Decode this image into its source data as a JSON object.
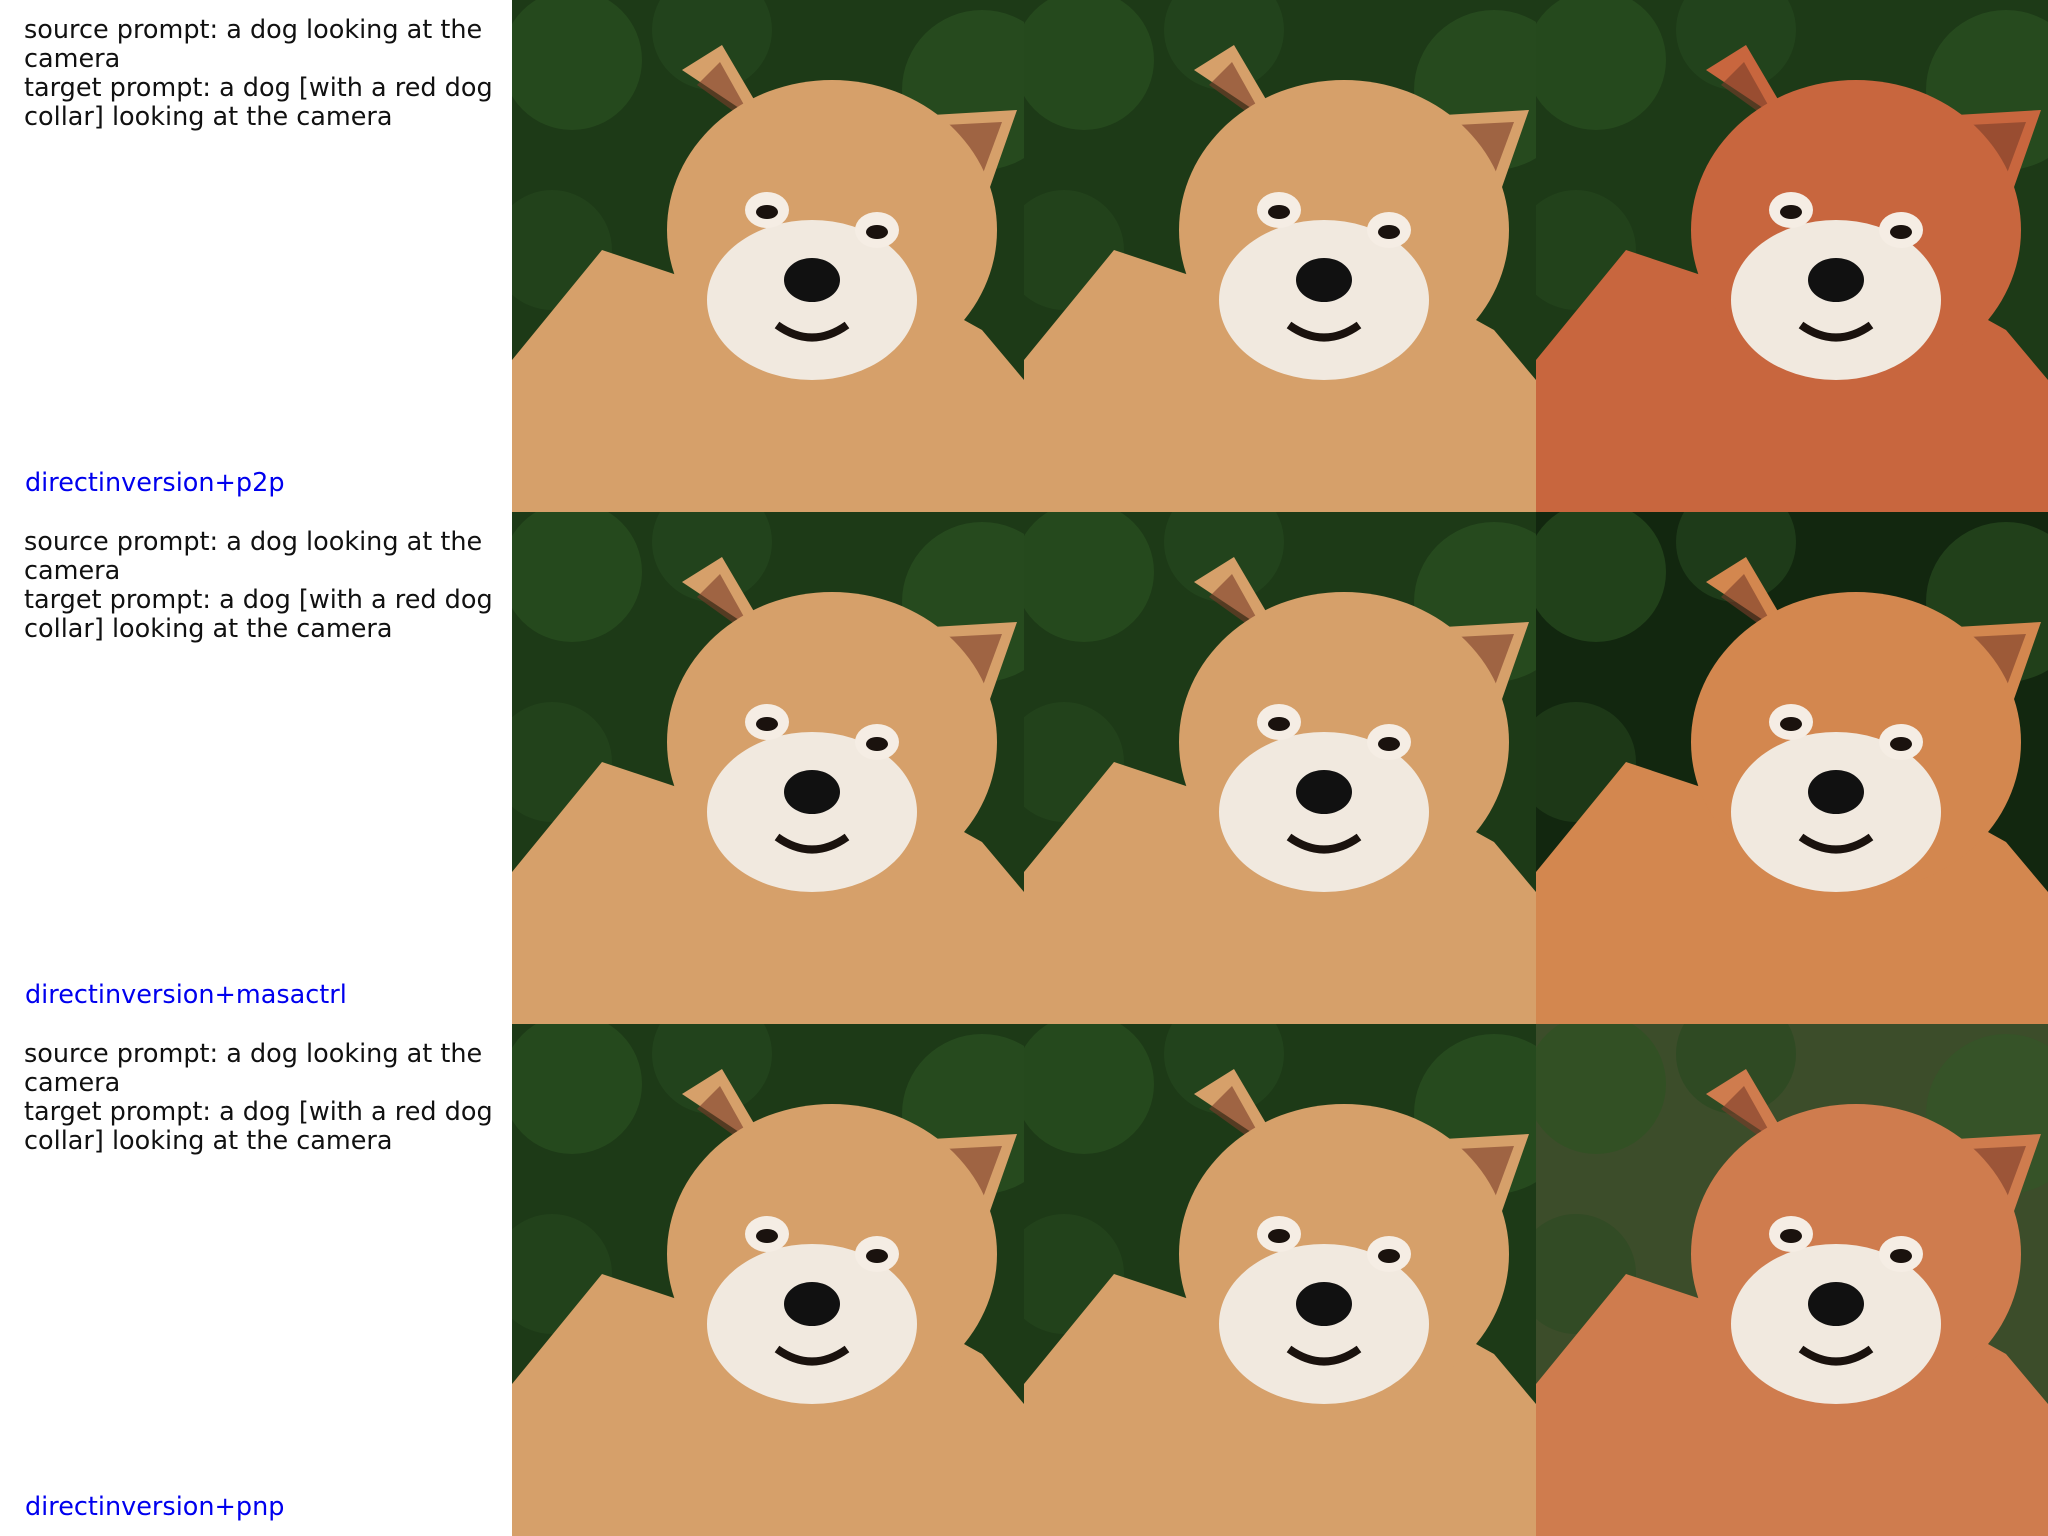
{
  "colors": {
    "method_label": "#0000ee",
    "text": "#111111",
    "background": "#ffffff"
  },
  "rows": [
    {
      "source_prompt": "source prompt: a dog looking at the camera",
      "target_prompt": "target prompt: a dog [with a red dog collar] looking at the camera",
      "method": "directinversion+p2p",
      "images": [
        {
          "variant": "source",
          "fur": "#d6a06a",
          "bg": "#1d3a17"
        },
        {
          "variant": "reconstruction",
          "fur": "#d6a06a",
          "bg": "#1d3a17"
        },
        {
          "variant": "edited",
          "fur": "#c8663e",
          "bg": "#1d3a17"
        }
      ]
    },
    {
      "source_prompt": "source prompt: a dog looking at the camera",
      "target_prompt": "target prompt: a dog [with a red dog collar] looking at the camera",
      "method": "directinversion+masactrl",
      "images": [
        {
          "variant": "source",
          "fur": "#d6a06a",
          "bg": "#1d3a17"
        },
        {
          "variant": "reconstruction",
          "fur": "#d6a06a",
          "bg": "#1d3a17"
        },
        {
          "variant": "edited",
          "fur": "#d3874f",
          "bg": "#12270f"
        }
      ]
    },
    {
      "source_prompt": "source prompt: a dog looking at the camera",
      "target_prompt": "target prompt: a dog [with a red dog collar] looking at the camera",
      "method": "directinversion+pnp",
      "images": [
        {
          "variant": "source",
          "fur": "#d6a06a",
          "bg": "#1d3a17"
        },
        {
          "variant": "reconstruction",
          "fur": "#d6a06a",
          "bg": "#1d3a17"
        },
        {
          "variant": "edited",
          "fur": "#cf7c4e",
          "bg": "#3c4d2a"
        }
      ]
    }
  ]
}
